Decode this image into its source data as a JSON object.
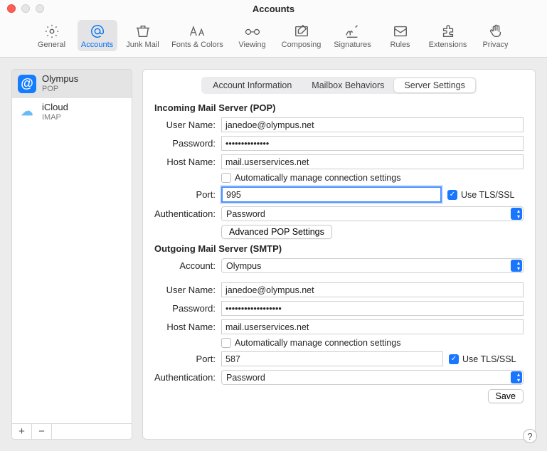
{
  "window": {
    "title": "Accounts"
  },
  "toolbar": {
    "items": [
      {
        "id": "general",
        "label": "General"
      },
      {
        "id": "accounts",
        "label": "Accounts",
        "selected": true
      },
      {
        "id": "junk",
        "label": "Junk Mail"
      },
      {
        "id": "fonts",
        "label": "Fonts & Colors"
      },
      {
        "id": "viewing",
        "label": "Viewing"
      },
      {
        "id": "composing",
        "label": "Composing"
      },
      {
        "id": "signatures",
        "label": "Signatures"
      },
      {
        "id": "rules",
        "label": "Rules"
      },
      {
        "id": "extensions",
        "label": "Extensions"
      },
      {
        "id": "privacy",
        "label": "Privacy"
      }
    ]
  },
  "sidebar": {
    "accounts": [
      {
        "name": "Olympus",
        "sub": "POP",
        "icon": "at",
        "selected": true
      },
      {
        "name": "iCloud",
        "sub": "IMAP",
        "icon": "cloud",
        "selected": false
      }
    ],
    "add_glyph": "+",
    "remove_glyph": "−"
  },
  "tabs": {
    "items": [
      {
        "label": "Account Information",
        "selected": false
      },
      {
        "label": "Mailbox Behaviors",
        "selected": false
      },
      {
        "label": "Server Settings",
        "selected": true
      }
    ]
  },
  "incoming": {
    "header": "Incoming Mail Server (POP)",
    "labels": {
      "username": "User Name:",
      "password": "Password:",
      "hostname": "Host Name:",
      "port": "Port:",
      "auth": "Authentication:"
    },
    "username": "janedoe@olympus.net",
    "password": "••••••••••••••",
    "hostname": "mail.userservices.net",
    "auto_label": "Automatically manage connection settings",
    "auto_checked": false,
    "port": "995",
    "tls_label": "Use TLS/SSL",
    "tls_checked": true,
    "auth": "Password",
    "advanced_btn": "Advanced POP Settings"
  },
  "outgoing": {
    "header": "Outgoing Mail Server (SMTP)",
    "labels": {
      "account": "Account:",
      "username": "User Name:",
      "password": "Password:",
      "hostname": "Host Name:",
      "port": "Port:",
      "auth": "Authentication:"
    },
    "account": "Olympus",
    "username": "janedoe@olympus.net",
    "password": "••••••••••••••••••",
    "hostname": "mail.userservices.net",
    "auto_label": "Automatically manage connection settings",
    "auto_checked": false,
    "port": "587",
    "tls_label": "Use TLS/SSL",
    "tls_checked": true,
    "auth": "Password"
  },
  "save_label": "Save",
  "help_label": "?"
}
